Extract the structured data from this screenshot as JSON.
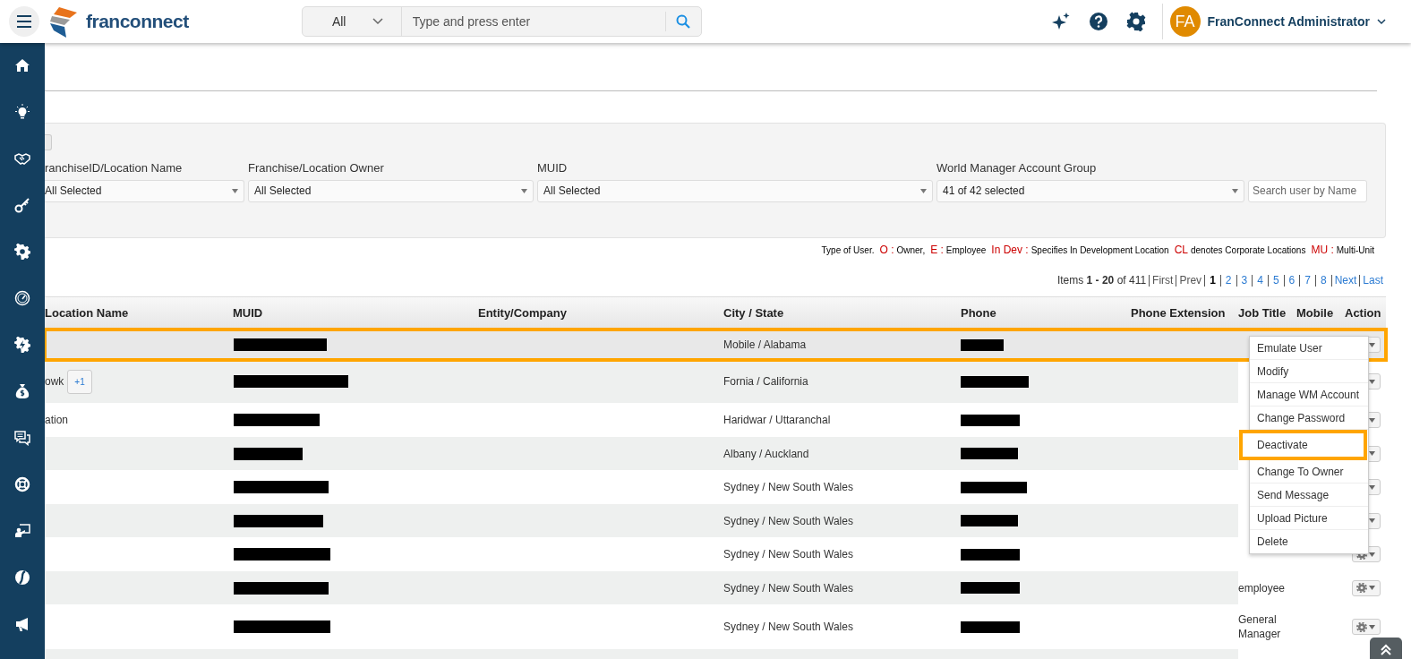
{
  "header": {
    "logo_text": "franconnect",
    "search": {
      "scope": "All",
      "placeholder": "Type and press enter"
    },
    "avatar": "FA",
    "user_name": "FranConnect Administrator"
  },
  "filters": [
    {
      "label": "ranchiseID/Location Name",
      "value": "All Selected"
    },
    {
      "label": "Franchise/Location Owner",
      "value": "All Selected"
    },
    {
      "label": "MUID",
      "value": "All Selected"
    },
    {
      "label": "World Manager Account Group",
      "value": "41 of 42 selected"
    }
  ],
  "name_search": {
    "placeholder": "Search user by Name"
  },
  "legend": {
    "prefix": "Type of User.",
    "items": [
      {
        "code": "O :",
        "text": "Owner,"
      },
      {
        "code": "E :",
        "text": "Employee"
      },
      {
        "code": "In Dev :",
        "text": "Specifies In Development Location"
      },
      {
        "code": "CL",
        "text": "denotes Corporate Locations"
      },
      {
        "code": "MU :",
        "text": "Multi-Unit"
      }
    ]
  },
  "pagination": {
    "summary": "Items **1 - 20** of 411",
    "links": [
      {
        "label": "First",
        "kind": "nav",
        "selected": false,
        "disabled": true
      },
      {
        "label": "Prev",
        "kind": "nav",
        "selected": false,
        "disabled": true
      },
      {
        "label": "1",
        "kind": "page",
        "selected": true,
        "disabled": false
      },
      {
        "label": "2",
        "kind": "page",
        "selected": false,
        "disabled": false
      },
      {
        "label": "3",
        "kind": "page",
        "selected": false,
        "disabled": false
      },
      {
        "label": "4",
        "kind": "page",
        "selected": false,
        "disabled": false
      },
      {
        "label": "5",
        "kind": "page",
        "selected": false,
        "disabled": false
      },
      {
        "label": "6",
        "kind": "page",
        "selected": false,
        "disabled": false
      },
      {
        "label": "7",
        "kind": "page",
        "selected": false,
        "disabled": false
      },
      {
        "label": "8",
        "kind": "page",
        "selected": false,
        "disabled": false
      },
      {
        "label": "Next",
        "kind": "nav",
        "selected": false,
        "disabled": false
      },
      {
        "label": "Last",
        "kind": "nav",
        "selected": false,
        "disabled": false
      }
    ]
  },
  "table": {
    "columns": [
      "Location Name",
      "MUID",
      "Entity/Company",
      "City / State",
      "Phone",
      "Phone Extension",
      "Job Title",
      "Mobile",
      "Action"
    ],
    "rows": [
      {
        "location": "",
        "badge": "",
        "city": "Mobile / Alabama",
        "job_title": "",
        "highlighted": true
      },
      {
        "location": "owk",
        "badge": "+1",
        "city": "Fornia / California",
        "job_title": "",
        "highlighted": false
      },
      {
        "location": "ation",
        "badge": "",
        "city": "Haridwar / Uttaranchal",
        "job_title": "",
        "highlighted": false
      },
      {
        "location": "",
        "badge": "",
        "city": "Albany / Auckland",
        "job_title": "",
        "highlighted": false
      },
      {
        "location": "",
        "badge": "",
        "city": "Sydney / New South Wales",
        "job_title": "",
        "highlighted": false
      },
      {
        "location": "",
        "badge": "",
        "city": "Sydney / New South Wales",
        "job_title": "",
        "highlighted": false
      },
      {
        "location": "",
        "badge": "",
        "city": "Sydney / New South Wales",
        "job_title": "",
        "highlighted": false
      },
      {
        "location": "",
        "badge": "",
        "city": "Sydney / New South Wales",
        "job_title": "employee",
        "highlighted": false
      },
      {
        "location": "",
        "badge": "",
        "city": "Sydney / New South Wales",
        "job_title": "General Manager",
        "highlighted": false
      }
    ]
  },
  "action_menu": {
    "items": [
      {
        "label": "Emulate User",
        "highlighted": false
      },
      {
        "label": "Modify",
        "highlighted": false
      },
      {
        "label": "Manage WM Account",
        "highlighted": false
      },
      {
        "label": "Change Password",
        "highlighted": false
      },
      {
        "label": "Deactivate",
        "highlighted": true
      },
      {
        "label": "Change To Owner",
        "highlighted": false
      },
      {
        "label": "Send Message",
        "highlighted": false
      },
      {
        "label": "Upload Picture",
        "highlighted": false
      },
      {
        "label": "Delete",
        "highlighted": false
      }
    ]
  }
}
